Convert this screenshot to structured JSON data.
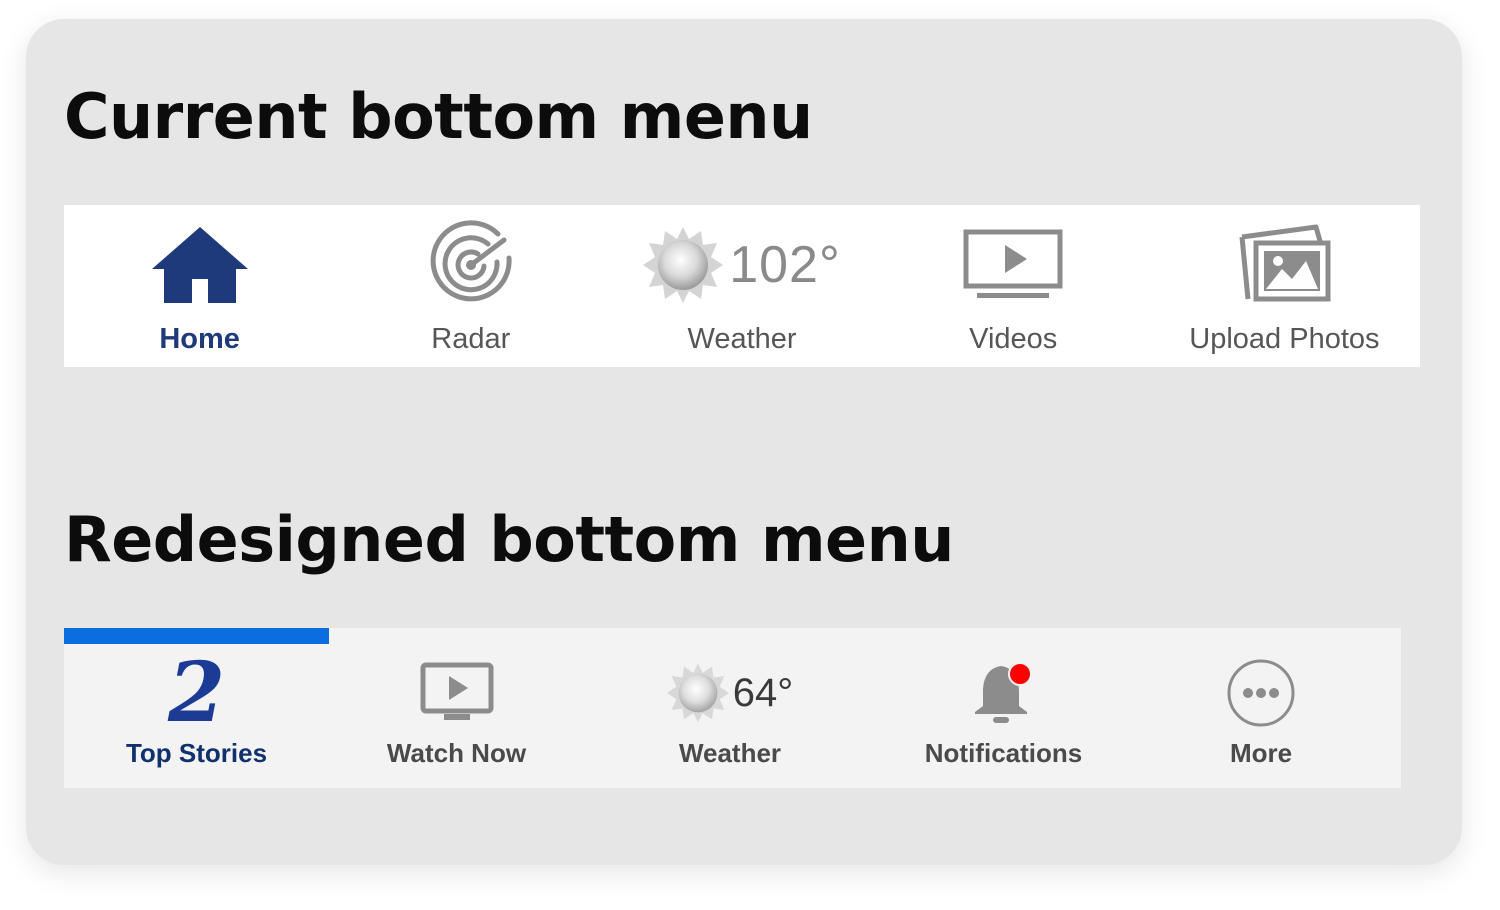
{
  "current": {
    "heading": "Current bottom menu",
    "items": [
      {
        "label": "Home",
        "icon": "home-icon",
        "active": true
      },
      {
        "label": "Radar",
        "icon": "radar-icon"
      },
      {
        "label": "Weather",
        "icon": "sun-icon",
        "temp": "102°"
      },
      {
        "label": "Videos",
        "icon": "video-icon"
      },
      {
        "label": "Upload Photos",
        "icon": "photos-icon"
      }
    ]
  },
  "redesigned": {
    "heading": "Redesigned bottom menu",
    "items": [
      {
        "label": "Top Stories",
        "icon": "channel-2-logo",
        "logo_text": "2",
        "active": true
      },
      {
        "label": "Watch Now",
        "icon": "tv-play-icon"
      },
      {
        "label": "Weather",
        "icon": "sun-icon",
        "temp": "64°"
      },
      {
        "label": "Notifications",
        "icon": "bell-icon"
      },
      {
        "label": "More",
        "icon": "more-icon"
      }
    ]
  },
  "colors": {
    "active_navy": "#1f3a7a",
    "indicator_blue": "#0a6ee0",
    "notification_dot": "#ff0000",
    "icon_gray": "#8c8c8c"
  }
}
